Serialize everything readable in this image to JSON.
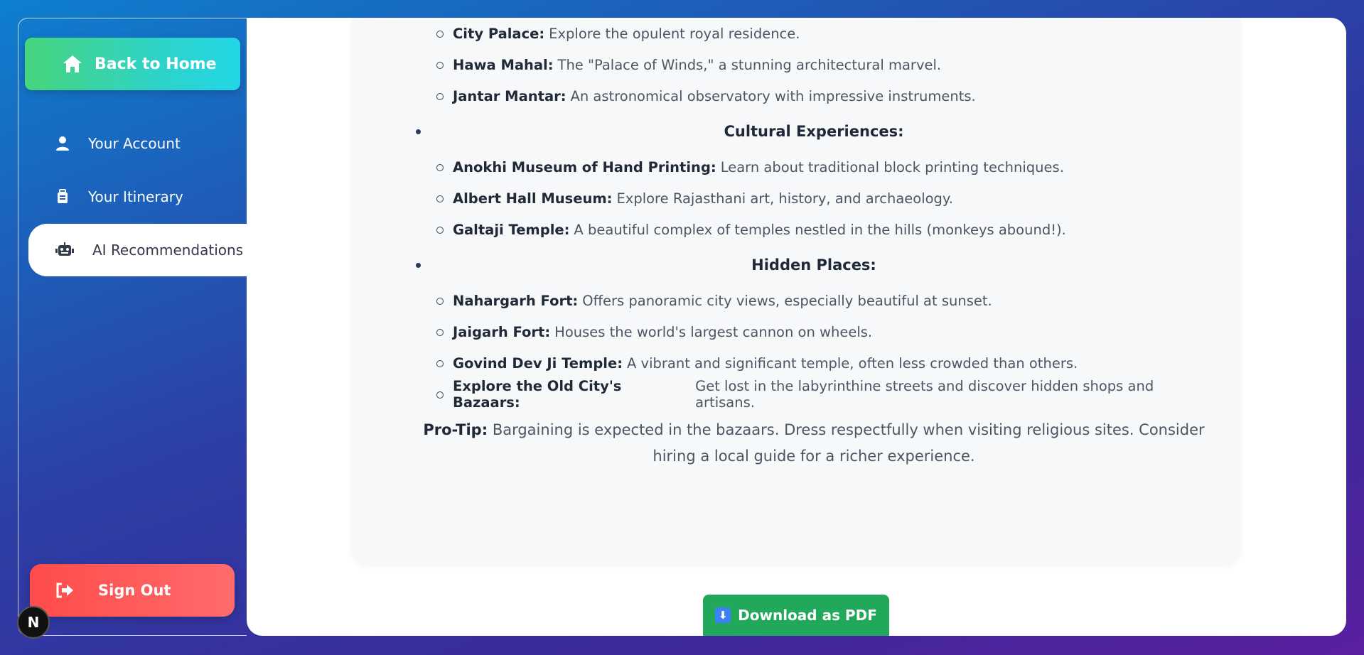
{
  "sidebar": {
    "back_home": "Back to Home",
    "items": [
      {
        "label": "Your Account",
        "icon": "user-icon"
      },
      {
        "label": "Your Itinerary",
        "icon": "luggage-icon"
      },
      {
        "label": "AI Recommendations",
        "icon": "robot-icon"
      }
    ],
    "sign_out": "Sign Out",
    "badge": "N"
  },
  "content": {
    "top_items": [
      {
        "name": "City Palace:",
        "desc": "Explore the opulent royal residence."
      },
      {
        "name": "Hawa Mahal:",
        "desc": "The \"Palace of Winds,\" a stunning architectural marvel."
      },
      {
        "name": "Jantar Mantar:",
        "desc": "An astronomical observatory with impressive instruments."
      }
    ],
    "cultural": {
      "heading": "Cultural Experiences:",
      "items": [
        {
          "name": "Anokhi Museum of Hand Printing:",
          "desc": "Learn about traditional block printing techniques."
        },
        {
          "name": "Albert Hall Museum:",
          "desc": "Explore Rajasthani art, history, and archaeology."
        },
        {
          "name": "Galtaji Temple:",
          "desc": "A beautiful complex of temples nestled in the hills (monkeys abound!)."
        }
      ]
    },
    "hidden": {
      "heading": "Hidden Places:",
      "items": [
        {
          "name": "Nahargarh Fort:",
          "desc": "Offers panoramic city views, especially beautiful at sunset."
        },
        {
          "name": "Jaigarh Fort:",
          "desc": "Houses the world's largest cannon on wheels."
        },
        {
          "name": "Govind Dev Ji Temple:",
          "desc": "A vibrant and significant temple, often less crowded than others."
        },
        {
          "name": "Explore the Old City's Bazaars:",
          "desc": "Get lost in the labyrinthine streets and discover hidden shops and artisans."
        }
      ]
    },
    "protip_label": "Pro-Tip:",
    "protip_text": "Bargaining is expected in the bazaars. Dress respectfully when visiting religious sites. Consider hiring a local guide for a richer experience."
  },
  "download": {
    "icon": "⬇",
    "label": "Download as PDF"
  }
}
